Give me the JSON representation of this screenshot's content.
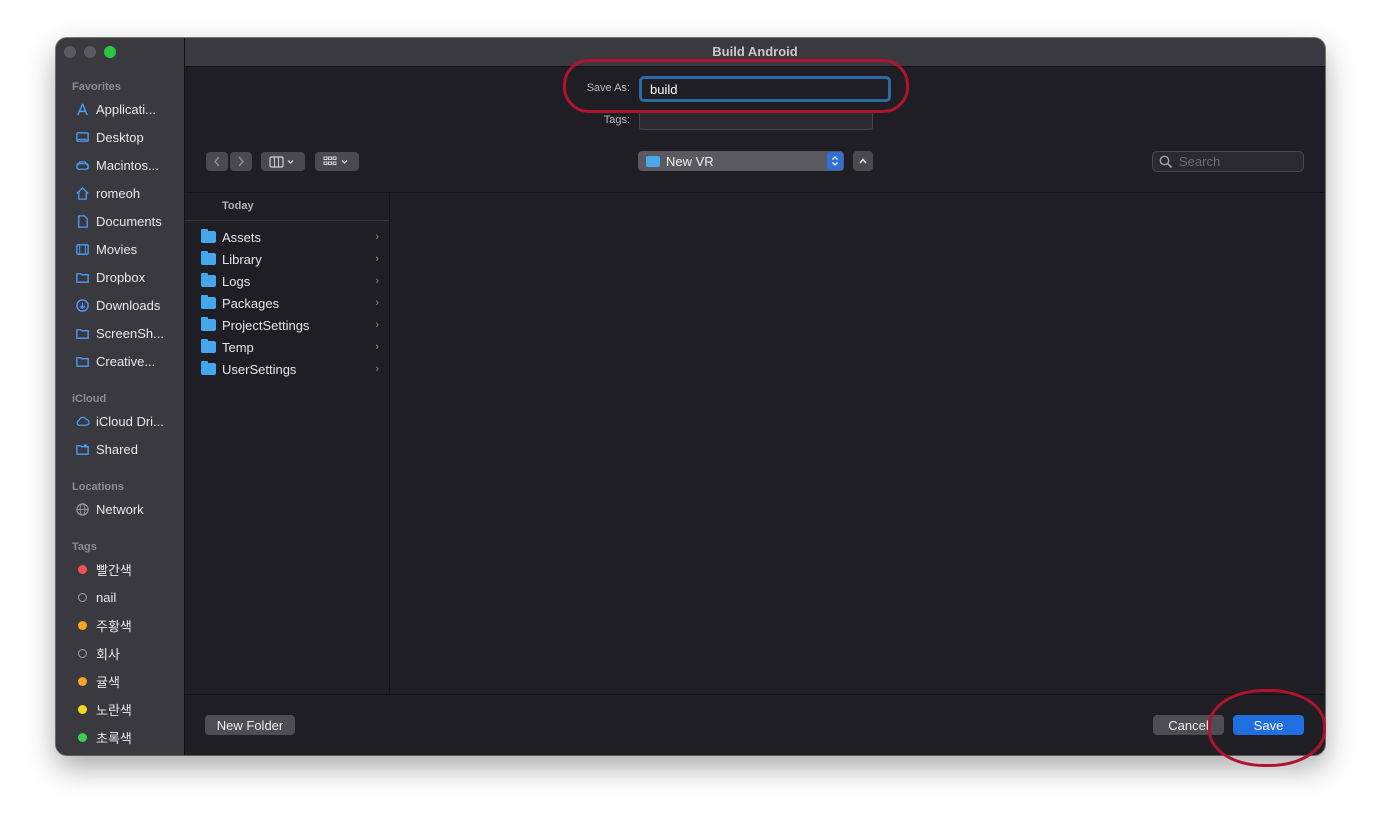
{
  "window": {
    "title": "Build Android"
  },
  "sidebar": {
    "favorites_heading": "Favorites",
    "favorites": [
      {
        "label": "Applicati...",
        "icon": "applications-icon"
      },
      {
        "label": "Desktop",
        "icon": "desktop-icon"
      },
      {
        "label": "Macintos...",
        "icon": "disk-icon"
      },
      {
        "label": "romeoh",
        "icon": "home-icon"
      },
      {
        "label": "Documents",
        "icon": "document-icon"
      },
      {
        "label": "Movies",
        "icon": "movies-icon"
      },
      {
        "label": "Dropbox",
        "icon": "folder-icon"
      },
      {
        "label": "Downloads",
        "icon": "downloads-icon"
      },
      {
        "label": "ScreenSh...",
        "icon": "folder-icon"
      },
      {
        "label": "Creative...",
        "icon": "folder-icon"
      }
    ],
    "icloud_heading": "iCloud",
    "icloud": [
      {
        "label": "iCloud Dri...",
        "icon": "cloud-icon"
      },
      {
        "label": "Shared",
        "icon": "shared-folder-icon"
      }
    ],
    "locations_heading": "Locations",
    "locations": [
      {
        "label": "Network",
        "icon": "network-icon"
      }
    ],
    "tags_heading": "Tags",
    "tags": [
      {
        "label": "빨간색",
        "color": "#ef5350"
      },
      {
        "label": "nail",
        "color": ""
      },
      {
        "label": "주황색",
        "color": "#f5a623"
      },
      {
        "label": "회사",
        "color": ""
      },
      {
        "label": "귤색",
        "color": "#f5a623"
      },
      {
        "label": "노란색",
        "color": "#f3d820"
      },
      {
        "label": "초록색",
        "color": "#3ccf4e"
      }
    ]
  },
  "form": {
    "save_as_label": "Save As:",
    "save_as_value": "build",
    "tags_label": "Tags:"
  },
  "toolbar": {
    "location": "New VR",
    "search_placeholder": "Search"
  },
  "browser": {
    "column_heading": "Today",
    "items": [
      "Assets",
      "Library",
      "Logs",
      "Packages",
      "ProjectSettings",
      "Temp",
      "UserSettings"
    ]
  },
  "footer": {
    "new_folder_label": "New Folder",
    "cancel_label": "Cancel",
    "save_label": "Save"
  },
  "colors": {
    "accent": "#1f6fe0",
    "annotation_ring": "#b0132e",
    "folder": "#45a7eb"
  }
}
